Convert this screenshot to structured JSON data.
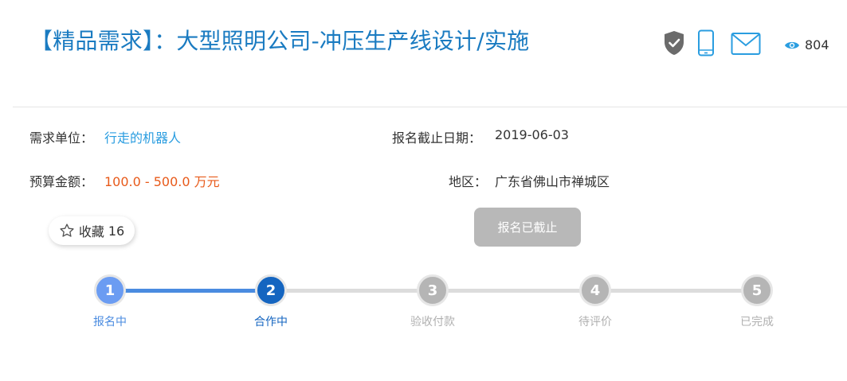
{
  "header": {
    "title": "【精品需求】：大型照明公司-冲压生产线设计/实施",
    "view_count": "804",
    "icons": [
      "shield-check-icon",
      "phone-icon",
      "mail-icon",
      "eye-icon"
    ]
  },
  "details": {
    "org_label": "需求单位：",
    "org_value": "行走的机器人",
    "deadline_label": "报名截止日期：",
    "deadline_value": "2019-06-03",
    "budget_label": "预算金额：",
    "budget_value": "100.0 - 500.0 万元",
    "region_label": "地区：",
    "region_value": "广东省佛山市禅城区"
  },
  "actions": {
    "favorite_label": "收藏",
    "favorite_count": "16",
    "signup_button_label": "报名已截止"
  },
  "progress": {
    "current_step": 2,
    "steps": [
      {
        "number": "1",
        "label": "报名中"
      },
      {
        "number": "2",
        "label": "合作中"
      },
      {
        "number": "3",
        "label": "验收付款"
      },
      {
        "number": "4",
        "label": "待评价"
      },
      {
        "number": "5",
        "label": "已完成"
      }
    ]
  },
  "colors": {
    "title_blue": "#1a7bc1",
    "link_blue": "#2a9de0",
    "budget_orange": "#e85a1a",
    "step_done": "#6b9cf2",
    "step_active": "#1565c0",
    "step_pending": "#b5b5b5",
    "disabled_button": "#b8b8b8"
  }
}
